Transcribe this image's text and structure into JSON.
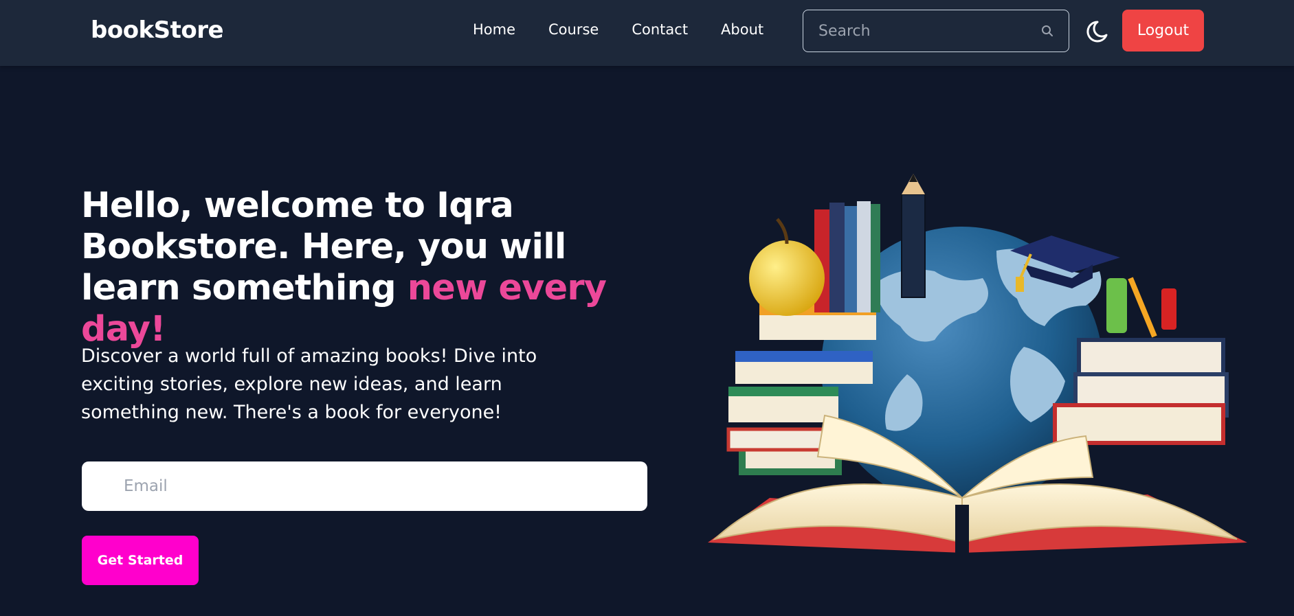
{
  "brand": {
    "name": "bookStore"
  },
  "nav": {
    "links": [
      "Home",
      "Course",
      "Contact",
      "About"
    ],
    "search_placeholder": "Search",
    "logout_label": "Logout"
  },
  "hero": {
    "title_main": "Hello, welcome to Iqra Bookstore. Here, you will learn something ",
    "title_accent": "new every day!",
    "description": "Discover a world full of amazing books! Dive into exciting stories, explore new ideas, and learn something new. There's a book for everyone!",
    "email_placeholder": "Email",
    "cta_label": "Get Started",
    "illustration": "books-globe-illustration"
  },
  "colors": {
    "background": "#0f172a",
    "navbar": "#1d283a",
    "accent_pink": "#ec4899",
    "cta_magenta": "#ff00cc",
    "logout_red": "#ef4444"
  }
}
